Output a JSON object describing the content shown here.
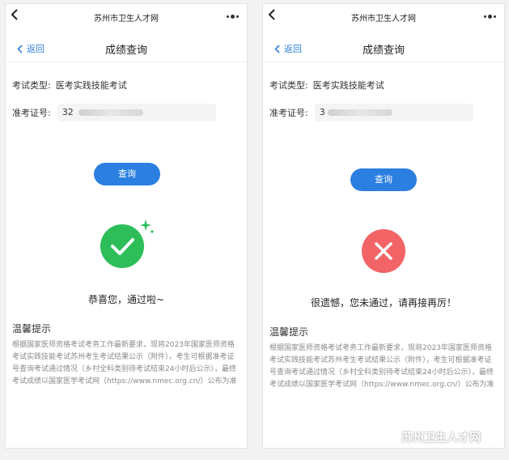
{
  "app": {
    "site_title": "苏州市卫生人才网",
    "back_label": "返回",
    "page_title": "成绩查询"
  },
  "screens": {
    "left": {
      "exam_type_label": "考试类型:",
      "exam_type_value": "医考实践技能考试",
      "ticket_label": "准考证号:",
      "ticket_value_visible": "32",
      "query_label": "查询",
      "result_text": "恭喜您，通过啦~",
      "result": "pass"
    },
    "right": {
      "exam_type_label": "考试类型:",
      "exam_type_value": "医考实践技能考试",
      "ticket_label": "准考证号:",
      "ticket_value_visible": "3",
      "query_label": "查询",
      "result_text": "很遗憾，您未通过，请再接再厉！",
      "result": "fail"
    }
  },
  "tips": {
    "title": "温馨提示",
    "body": "根据国家医师资格考试考务工作最新要求，现将2023年国家医师资格考试实践技能考试苏州考生考试结果公示（附件），考生可根据准考证号查询考试通过情况（乡村全科类别待考试结束24小时后公示），最终考试成绩以国家医学考试网（https://www.nmec.org.cn/）公布为准"
  },
  "watermark": {
    "text": "苏州卫生人才网",
    "icon": "wechat-icon"
  },
  "colors": {
    "accent": "#2b7fe0",
    "back_link": "#2f7fd8",
    "pass": "#2dbe5a",
    "fail": "#f26466",
    "tip_text": "#8a8a8a"
  }
}
